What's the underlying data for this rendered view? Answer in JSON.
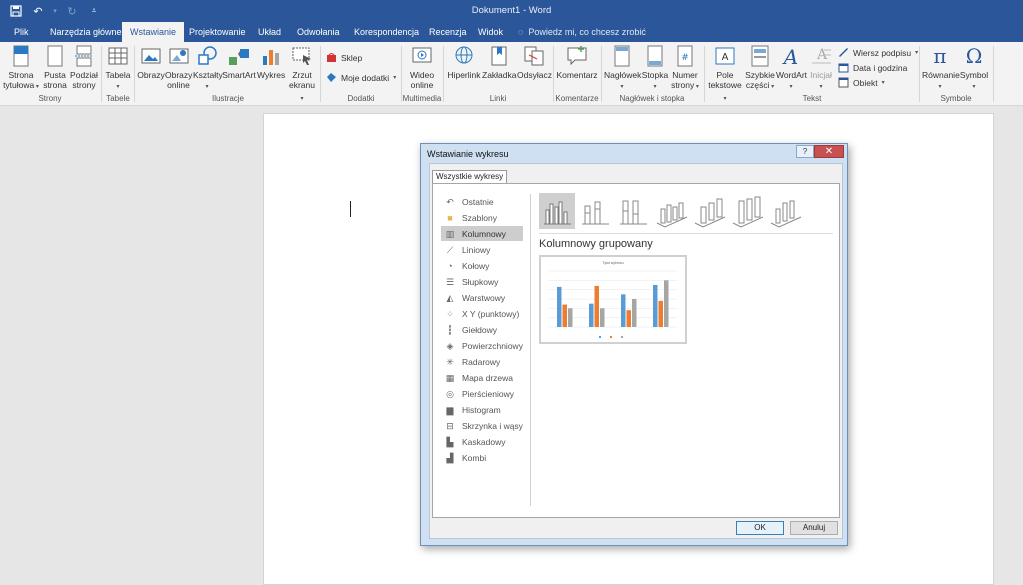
{
  "window": {
    "title": "Dokument1 - Word"
  },
  "qat": {
    "save_icon": "save-icon",
    "undo_icon": "undo-icon",
    "redo_icon": "redo-icon",
    "customize_icon": "customize-qat-icon"
  },
  "tabs": [
    {
      "label": "Plik"
    },
    {
      "label": "Narzędzia główne"
    },
    {
      "label": "Wstawianie"
    },
    {
      "label": "Projektowanie"
    },
    {
      "label": "Układ"
    },
    {
      "label": "Odwołania"
    },
    {
      "label": "Korespondencja"
    },
    {
      "label": "Recenzja"
    },
    {
      "label": "Widok"
    }
  ],
  "tell_me": "Powiedz mi, co chcesz zrobić",
  "ribbon": {
    "strony": {
      "cover_l1": "Strona",
      "cover_l2": "tytułowa",
      "blank_l1": "Pusta",
      "blank_l2": "strona",
      "break_l1": "Podział",
      "break_l2": "strony",
      "label": "Strony"
    },
    "tabele": {
      "table": "Tabela",
      "label": "Tabele"
    },
    "ilustracje": {
      "pictures": "Obrazy",
      "online_l1": "Obrazy",
      "online_l2": "online",
      "shapes": "Kształty",
      "smartart": "SmartArt",
      "chart": "Wykres",
      "screenshot_l1": "Zrzut",
      "screenshot_l2": "ekranu",
      "label": "Ilustracje"
    },
    "dodatki": {
      "store": "Sklep",
      "my_addins": "Moje dodatki",
      "label": "Dodatki"
    },
    "multimedia": {
      "video_l1": "Wideo",
      "video_l2": "online",
      "label": "Multimedia"
    },
    "linki": {
      "hyperlink": "Hiperlink",
      "bookmark": "Zakładka",
      "crossref": "Odsyłacz",
      "label": "Linki"
    },
    "komentarze": {
      "comment": "Komentarz",
      "label": "Komentarze"
    },
    "naglowek": {
      "header": "Nagłówek",
      "footer": "Stopka",
      "pagenum_l1": "Numer",
      "pagenum_l2": "strony",
      "label": "Nagłówek i stopka"
    },
    "tekst": {
      "textbox_l1": "Pole",
      "textbox_l2": "tekstowe",
      "quickparts_l1": "Szybkie",
      "quickparts_l2": "części",
      "wordart": "WordArt",
      "dropcap": "Inicjał",
      "signature": "Wiersz podpisu",
      "datetime": "Data i godzina",
      "object": "Obiekt",
      "label": "Tekst"
    },
    "symbole": {
      "equation": "Równanie",
      "symbol": "Symbol",
      "label": "Symbole"
    }
  },
  "dialog": {
    "title": "Wstawianie wykresu",
    "help": "?",
    "close": "✕",
    "tab": "Wszystkie wykresy",
    "categories": [
      {
        "label": "Ostatnie",
        "icon": "recent-icon"
      },
      {
        "label": "Szablony",
        "icon": "folder-icon"
      },
      {
        "label": "Kolumnowy",
        "icon": "column-chart-icon",
        "selected": true
      },
      {
        "label": "Liniowy",
        "icon": "line-chart-icon"
      },
      {
        "label": "Kołowy",
        "icon": "pie-chart-icon"
      },
      {
        "label": "Słupkowy",
        "icon": "bar-chart-icon"
      },
      {
        "label": "Warstwowy",
        "icon": "area-chart-icon"
      },
      {
        "label": "X Y (punktowy)",
        "icon": "scatter-chart-icon"
      },
      {
        "label": "Giełdowy",
        "icon": "stock-chart-icon"
      },
      {
        "label": "Powierzchniowy",
        "icon": "surface-chart-icon"
      },
      {
        "label": "Radarowy",
        "icon": "radar-chart-icon"
      },
      {
        "label": "Mapa drzewa",
        "icon": "treemap-chart-icon"
      },
      {
        "label": "Pierścieniowy",
        "icon": "sunburst-chart-icon"
      },
      {
        "label": "Histogram",
        "icon": "histogram-chart-icon"
      },
      {
        "label": "Skrzynka i wąsy",
        "icon": "box-whisker-chart-icon"
      },
      {
        "label": "Kaskadowy",
        "icon": "waterfall-chart-icon"
      },
      {
        "label": "Kombi",
        "icon": "combo-chart-icon"
      }
    ],
    "subtype_title": "Kolumnowy grupowany",
    "preview_title": "Tytuł wykresu",
    "ok": "OK",
    "cancel": "Anuluj"
  },
  "preview_colors": {
    "series1": "#5b9bd5",
    "series2": "#ed7d31",
    "series3": "#a5a5a5"
  },
  "preview_values": [
    [
      4.3,
      2.4,
      2.0
    ],
    [
      2.5,
      4.4,
      2.0
    ],
    [
      3.5,
      1.8,
      3.0
    ],
    [
      4.5,
      2.8,
      5.0
    ]
  ],
  "accent": "#2b579a"
}
